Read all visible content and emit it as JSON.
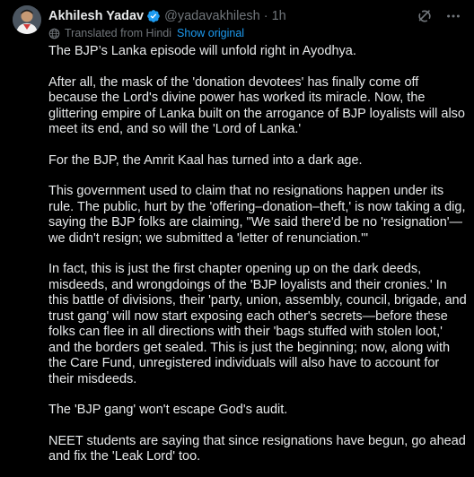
{
  "post": {
    "author_name": "Akhilesh Yadav",
    "handle": "@yadavakhilesh",
    "separator": "·",
    "time": "1h",
    "translated_label": "Translated from Hindi",
    "show_original_label": "Show original",
    "paragraphs": [
      "The BJP’s Lanka episode will unfold right in Ayodhya.",
      "After all, the mask of the 'donation devotees' has finally come off because the Lord's divine power has worked its miracle. Now, the glittering empire of Lanka built on the arrogance of BJP loyalists will also meet its end, and so will the 'Lord of Lanka.'",
      "For the BJP, the Amrit Kaal has turned into a dark age.",
      "This government used to claim that no resignations happen under its rule. The public, hurt by the 'offering–donation–theft,' is now taking a dig, saying the BJP folks are claiming, \"We said there'd be no 'resignation'—we didn't resign; we submitted a 'letter of renunciation.'\"",
      "In fact, this is just the first chapter opening up on the dark deeds, misdeeds, and wrongdoings of the 'BJP loyalists and their cronies.' In this battle of divisions, their 'party, union, assembly, council, brigade, and trust gang' will now start exposing each other's secrets—before these folks can flee in all directions with their 'bags stuffed with stolen loot,' and the borders get sealed. This is just the beginning; now, along with the Care Fund, unregistered individuals will also have to account for their misdeeds.",
      "The 'BJP gang' won't escape God's audit.",
      "NEET students are saying that since resignations have begun, go ahead and fix the 'Leak Lord' too."
    ]
  },
  "icons": {
    "verified": "verified-badge-icon",
    "grok": "grok-icon",
    "more": "more-options-icon",
    "globe": "globe-icon"
  },
  "colors": {
    "background": "#000000",
    "text": "#e7e9ea",
    "secondary_text": "#71767b",
    "link": "#1d9bf0",
    "verified": "#1d9bf0"
  }
}
